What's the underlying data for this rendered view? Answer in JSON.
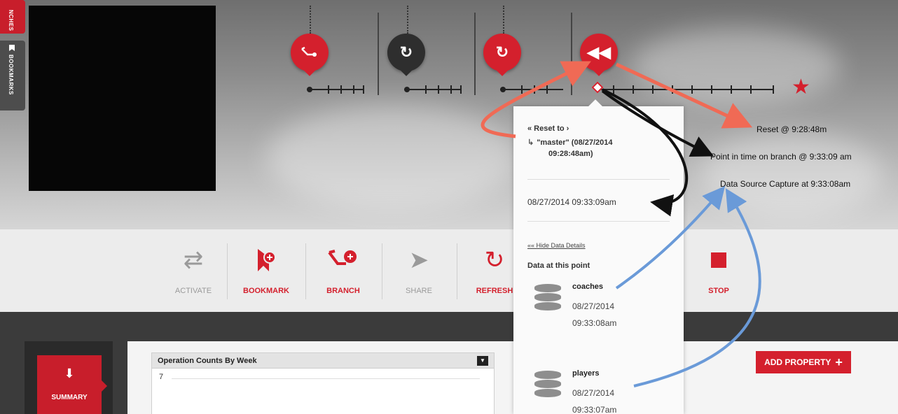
{
  "side_tabs": {
    "branches": "NCHES",
    "bookmarks": "BOOKMARKS"
  },
  "timeline": {
    "pins": [
      {
        "icon": "branch-icon",
        "style": "red"
      },
      {
        "icon": "refresh-icon",
        "style": "dark"
      },
      {
        "icon": "refresh-clock-icon",
        "style": "red"
      },
      {
        "icon": "rewind-icon",
        "style": "red"
      }
    ],
    "end_marker": "star-icon"
  },
  "toolbar": {
    "activate": "ACTIVATE",
    "bookmark": "BOOKMARK",
    "branch": "BRANCH",
    "share": "SHARE",
    "refresh": "REFRESH",
    "stop": "STOP"
  },
  "popup": {
    "reset_to": "« Reset to ›",
    "reset_target_line1": "\"master\" (08/27/2014",
    "reset_target_line2": "09:28:48am)",
    "point_in_time": "08/27/2014 09:33:09am",
    "hide_link": "«« Hide Data Details",
    "data_header": "Data at this point",
    "sources": [
      {
        "name": "coaches",
        "date": "08/27/2014",
        "time": "09:33:08am"
      },
      {
        "name": "players",
        "date": "08/27/2014",
        "time": "09:33:07am"
      }
    ]
  },
  "annotations": {
    "reset": "Reset @ 9:28:48m",
    "point_in_time": "Point in time on branch @ 9:33:09 am",
    "data_source": "Data Source Capture at 9:33:08am"
  },
  "summary": {
    "label": "SUMMARY"
  },
  "chart_panel": {
    "title": "Operation Counts By Week",
    "first_tick": "7"
  },
  "add_property": {
    "label": "ADD PROPERTY",
    "icon": "plus-icon"
  },
  "colors": {
    "accent": "#d4202d",
    "dark": "#2e2e2e",
    "annotation_red": "#f06a55",
    "annotation_blue": "#6a9ad8"
  }
}
